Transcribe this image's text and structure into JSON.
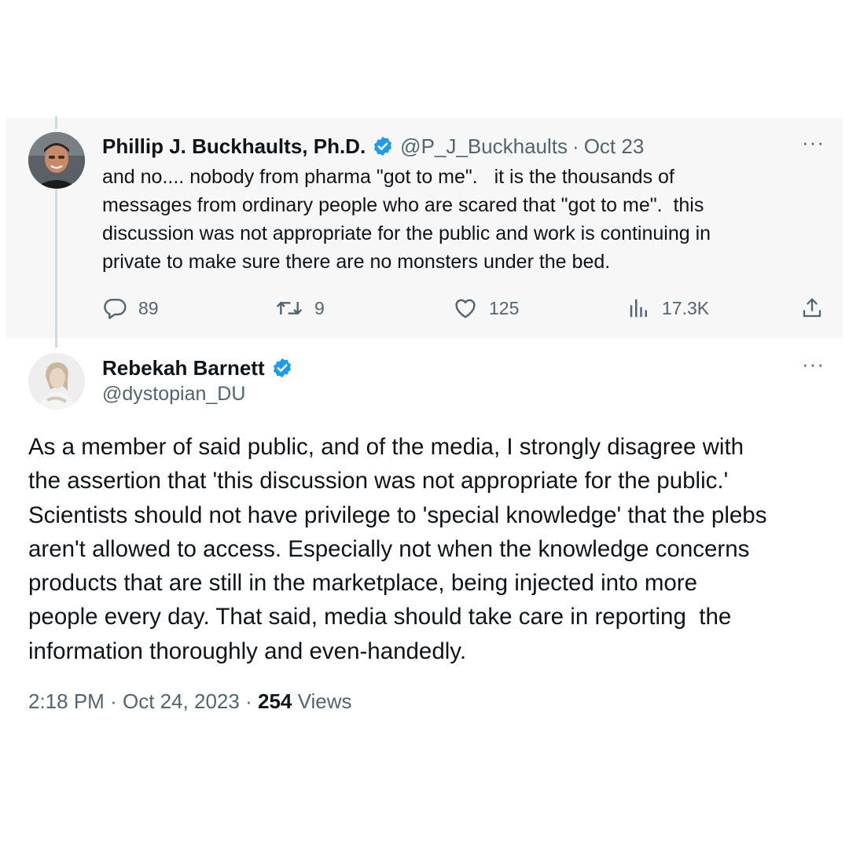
{
  "quoted_tweet": {
    "display_name": "Phillip J. Buckhaults, Ph.D.",
    "handle": "@P_J_Buckhaults",
    "separator": "·",
    "date": "Oct 23",
    "verified": true,
    "text_lines": [
      "and no.... nobody from pharma \"got to me\".   it is the thousands of",
      "messages from ordinary people who are scared that \"got to me\".  this",
      "discussion was not appropriate for the public and work is continuing in",
      "private to make sure there are no monsters under the bed."
    ],
    "actions": {
      "replies": "89",
      "retweets": "9",
      "likes": "125",
      "views": "17.3K"
    },
    "more_label": "···"
  },
  "main_tweet": {
    "display_name": "Rebekah Barnett",
    "handle": "@dystopian_DU",
    "verified": true,
    "more_label": "···",
    "text_lines": [
      "As a member of said public, and of the media, I strongly disagree with",
      "the assertion that 'this discussion was not appropriate for the public.'",
      "Scientists should not have privilege to 'special knowledge' that the plebs",
      "aren't allowed to access. Especially not when the knowledge concerns",
      "products that are still in the marketplace, being injected into more",
      "people every day. That said, media should take care in reporting  the",
      "information thoroughly and even-handedly."
    ],
    "time": "2:18 PM",
    "separator": "·",
    "date": "Oct 24, 2023",
    "views_count": "254",
    "views_label": "Views"
  },
  "colors": {
    "verified_badge": "#1d9bf0",
    "secondary_text": "#536471",
    "primary_text": "#0f1419",
    "quoted_background": "#f7f7f7"
  },
  "icons": [
    "reply-icon",
    "retweet-icon",
    "like-icon",
    "views-icon",
    "share-icon",
    "verified-badge-icon",
    "more-icon"
  ]
}
